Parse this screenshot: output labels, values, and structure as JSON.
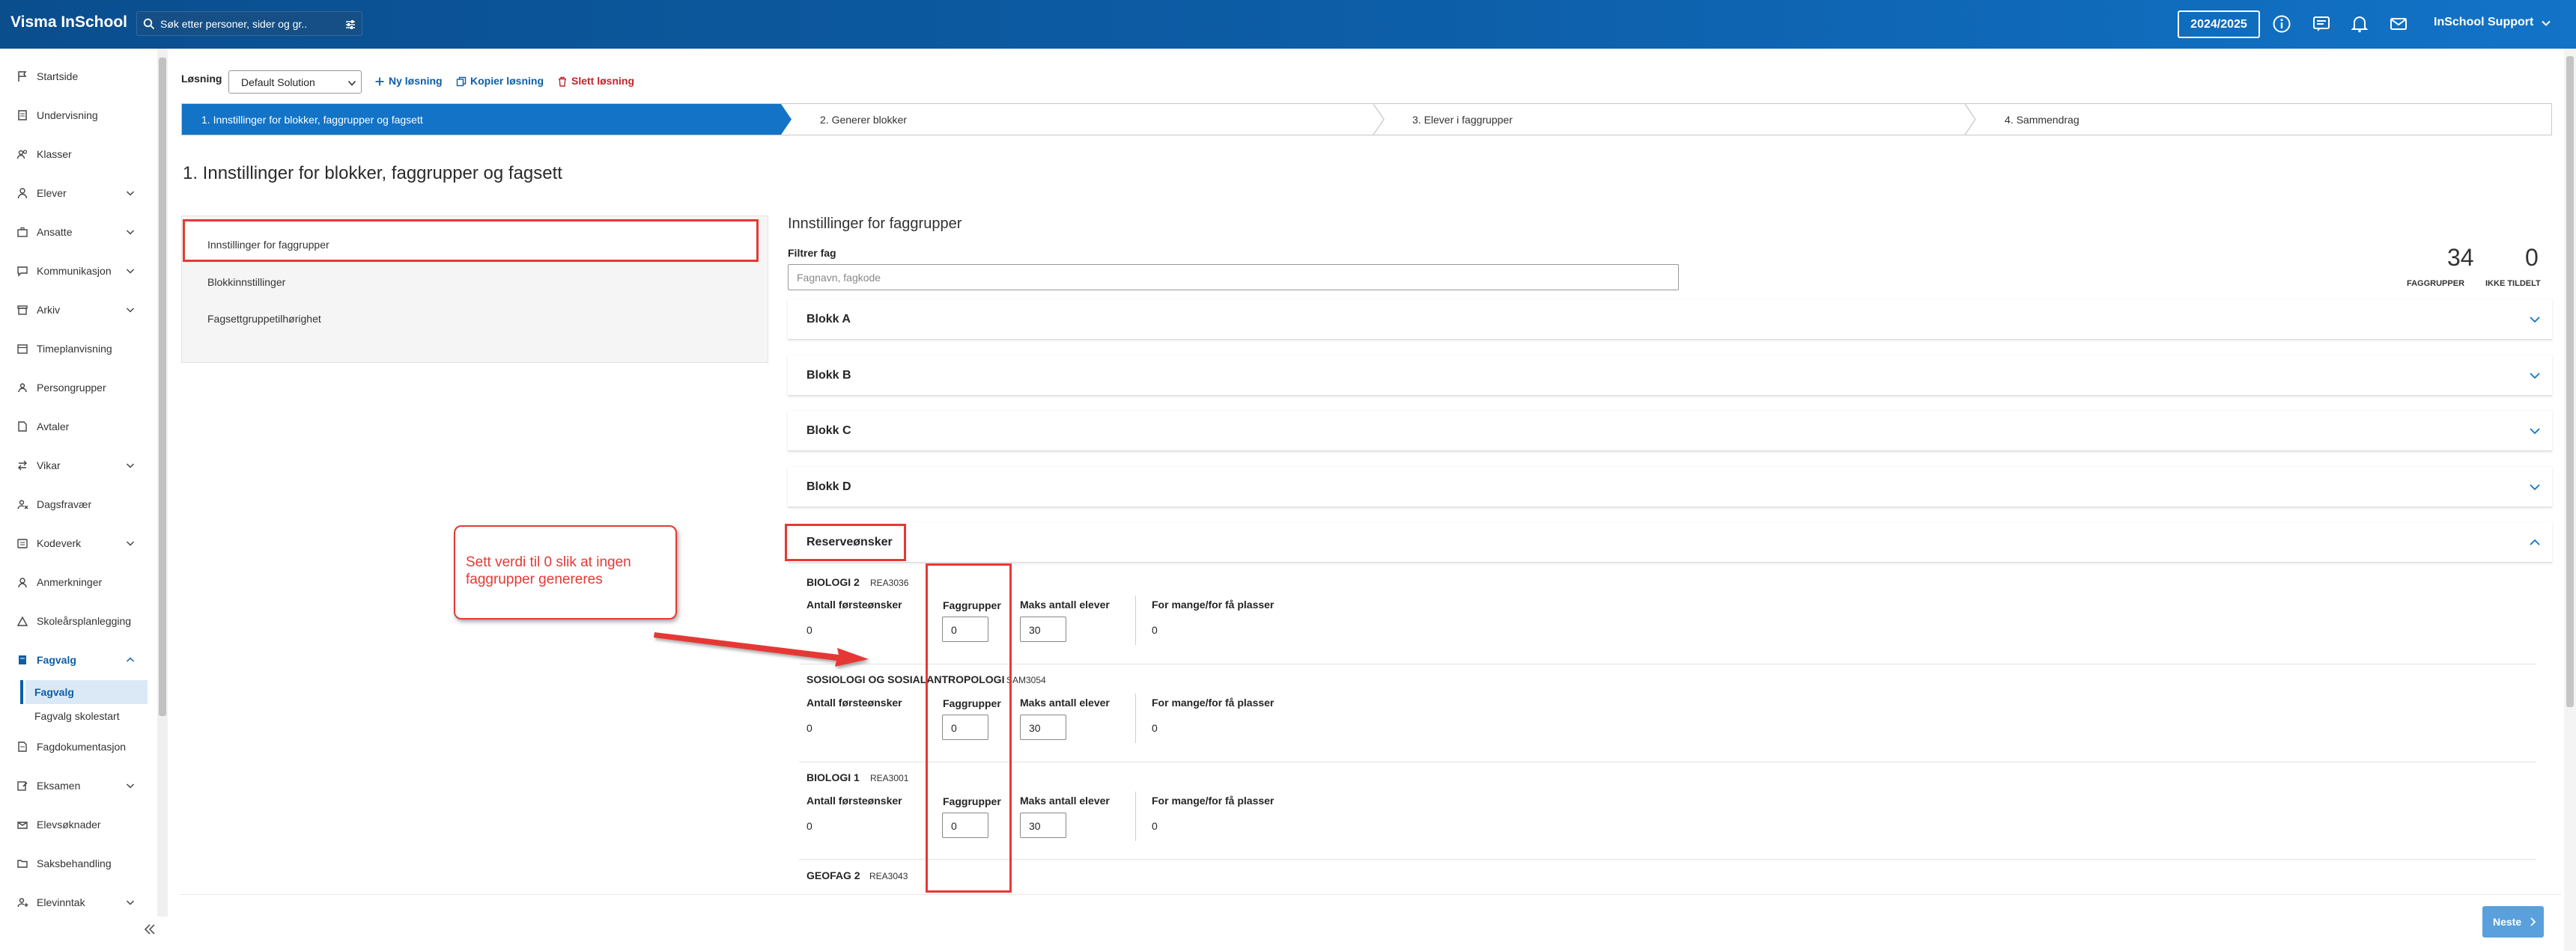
{
  "header": {
    "brand": "Visma InSchool",
    "search_placeholder": "Søk etter personer, sider og gr..",
    "school_year": "2024/2025",
    "user": "InSchool Support",
    "icons": [
      "search-icon",
      "filter-icon",
      "info-icon",
      "message-icon",
      "bell-icon",
      "mail-icon",
      "chevron-down-icon"
    ]
  },
  "sidebar": {
    "items": [
      {
        "label": "Startside",
        "icon": "flag-icon"
      },
      {
        "label": "Undervisning",
        "icon": "book-icon"
      },
      {
        "label": "Klasser",
        "icon": "users-icon"
      },
      {
        "label": "Elever",
        "icon": "student-icon"
      },
      {
        "label": "Ansatte",
        "icon": "briefcase-icon"
      },
      {
        "label": "Kommunikasjon",
        "icon": "chat-icon"
      },
      {
        "label": "Arkiv",
        "icon": "archive-icon"
      },
      {
        "label": "Timeplanvisning",
        "icon": "calendar-icon"
      },
      {
        "label": "Persongrupper",
        "icon": "group-icon"
      },
      {
        "label": "Avtaler",
        "icon": "document-icon"
      },
      {
        "label": "Vikar",
        "icon": "swap-icon"
      },
      {
        "label": "Dagsfravær",
        "icon": "absence-icon"
      },
      {
        "label": "Kodeverk",
        "icon": "code-icon"
      },
      {
        "label": "Anmerkninger",
        "icon": "remark-icon"
      },
      {
        "label": "Skoleårsplanlegging",
        "icon": "plan-icon"
      },
      {
        "label": "Fagvalg",
        "icon": "book-icon"
      },
      {
        "label": "Fagdokumentasjon",
        "icon": "doc-icon"
      },
      {
        "label": "Eksamen",
        "icon": "exam-icon"
      },
      {
        "label": "Elevsøknader",
        "icon": "application-icon"
      },
      {
        "label": "Saksbehandling",
        "icon": "folder-icon"
      },
      {
        "label": "Elevinntak",
        "icon": "intake-icon"
      }
    ],
    "sub_items": [
      {
        "label": "Fagvalg"
      },
      {
        "label": "Fagvalg skolestart"
      }
    ]
  },
  "toolbar": {
    "losning_label": "Løsning",
    "solution": "Default Solution",
    "new_label": "Ny løsning",
    "copy_label": "Kopier løsning",
    "delete_label": "Slett løsning"
  },
  "steps": [
    {
      "label": "1. Innstillinger for blokker, faggrupper og fagsett"
    },
    {
      "label": "2. Generer blokker"
    },
    {
      "label": "3. Elever i faggrupper"
    },
    {
      "label": "4. Sammendrag"
    }
  ],
  "page_title": "1. Innstillinger for blokker, faggrupper og fagsett",
  "left_menu": [
    {
      "label": "Innstillinger for faggrupper"
    },
    {
      "label": "Blokkinnstillinger"
    },
    {
      "label": "Fagsettgruppetilhørighet"
    }
  ],
  "right": {
    "title": "Innstillinger for faggrupper",
    "filter_label": "Filtrer fag",
    "filter_placeholder": "Fagnavn, fagkode",
    "stats": [
      {
        "value": "34",
        "label": "FAGGRUPPER"
      },
      {
        "value": "0",
        "label": "IKKE TILDELT"
      }
    ],
    "blocks": [
      {
        "title": "Blokk A"
      },
      {
        "title": "Blokk B"
      },
      {
        "title": "Blokk C"
      },
      {
        "title": "Blokk D"
      },
      {
        "title": "Reserveønsker"
      }
    ],
    "columns": {
      "first_choices": "Antall førsteønsker",
      "groups": "Faggrupper",
      "max_students": "Maks antall elever",
      "too_many": "For mange/for få plasser"
    },
    "subjects": [
      {
        "name": "BIOLOGI 2",
        "code": "REA3036",
        "first_choices": "0",
        "groups": "0",
        "max": "30",
        "diff": "0"
      },
      {
        "name": "SOSIOLOGI OG SOSIALANTROPOLOGI",
        "code": "SAM3054",
        "first_choices": "0",
        "groups": "0",
        "max": "30",
        "diff": "0"
      },
      {
        "name": "BIOLOGI 1",
        "code": "REA3001",
        "first_choices": "0",
        "groups": "0",
        "max": "30",
        "diff": "0"
      },
      {
        "name": "GEOFAG 2",
        "code": "REA3043"
      }
    ]
  },
  "annotation": {
    "text": "Sett verdi til 0 slik at ingen faggrupper genereres",
    "color": "#e53935"
  },
  "footer": {
    "next_label": "Neste"
  },
  "colors": {
    "accent": "#1273c7",
    "header": "#0d5ea8",
    "danger": "#c0252b"
  }
}
